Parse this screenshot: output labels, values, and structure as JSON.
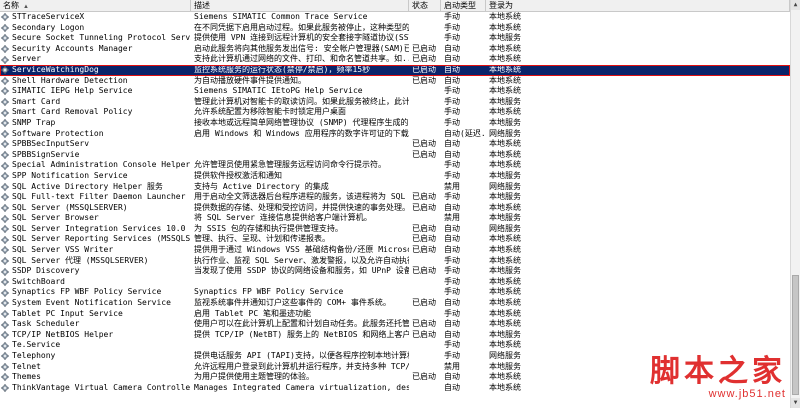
{
  "columns": [
    "名称",
    "描述",
    "状态",
    "启动类型",
    "登录为"
  ],
  "rows": [
    {
      "name": "STTraceServiceX",
      "desc": "Siemens SIMATIC Common Trace Service",
      "status": "",
      "start": "手动",
      "login": "本地系统"
    },
    {
      "name": "Secondary Logon",
      "desc": "在不同凭据下启用启动过程。如果此服务被停止，这种类型的登录...",
      "status": "",
      "start": "手动",
      "login": "本地系统"
    },
    {
      "name": "Secure Socket Tunneling Protocol Service",
      "desc": "提供使用 VPN 连接到远程计算机的安全套接字隧道协议(SSTP)的...",
      "status": "",
      "start": "手动",
      "login": "本地服务"
    },
    {
      "name": "Security Accounts Manager",
      "desc": "启动此服务将向其他服务发出信号: 安全帐户管理器(SAM)已准备...",
      "status": "已启动",
      "start": "自动",
      "login": "本地系统"
    },
    {
      "name": "Server",
      "desc": "支持此计算机通过网络的文件、打印、和命名管道共享。如...",
      "status": "已启动",
      "start": "自动",
      "login": "本地系统"
    },
    {
      "name": "ServiceWatchingDog",
      "desc": "监控系统服务的运行状态(禁停/禁启)，频率15秒",
      "status": "已启动",
      "start": "自动",
      "login": "本地系统",
      "selected": true
    },
    {
      "name": "Shell Hardware Detection",
      "desc": "为自动播放硬件事件提供通知。",
      "status": "已启动",
      "start": "自动",
      "login": "本地系统"
    },
    {
      "name": "SIMATIC IEPG Help Service",
      "desc": "Siemens SIMATIC IEtoPG Help Service",
      "status": "",
      "start": "手动",
      "login": "本地系统"
    },
    {
      "name": "Smart Card",
      "desc": "管理此计算机对智能卡的取读访问。如果此服务被终止，此计算机...",
      "status": "",
      "start": "手动",
      "login": "本地服务"
    },
    {
      "name": "Smart Card Removal Policy",
      "desc": "允许系统配置为移除智能卡时锁定用户桌面",
      "status": "",
      "start": "手动",
      "login": "本地系统"
    },
    {
      "name": "SNMP Trap",
      "desc": "接收本地或远程简单网络管理协议 (SNMP) 代理程序生成的陷阱消...",
      "status": "",
      "start": "手动",
      "login": "本地服务"
    },
    {
      "name": "Software Protection",
      "desc": "启用 Windows 和 Windows 应用程序的数字许可证的下载、安装和...",
      "status": "",
      "start": "自动(延迟...",
      "login": "网络服务"
    },
    {
      "name": "SPBBSecInputServ",
      "desc": "",
      "status": "已启动",
      "start": "自动",
      "login": "本地系统"
    },
    {
      "name": "SPBBSignServie",
      "desc": "",
      "status": "已启动",
      "start": "自动",
      "login": "本地系统"
    },
    {
      "name": "Special Administration Console Helper",
      "desc": "允许管理员使用紧急管理服务远程访问命令行提示符。",
      "status": "",
      "start": "手动",
      "login": "本地系统"
    },
    {
      "name": "SPP Notification Service",
      "desc": "提供软件授权激活和通知",
      "status": "",
      "start": "手动",
      "login": "本地服务"
    },
    {
      "name": "SQL Active Directory Helper 服务",
      "desc": "支持与 Active Directory 的集成",
      "status": "",
      "start": "禁用",
      "login": "网络服务"
    },
    {
      "name": "SQL Full-text Filter Daemon Launcher (MSSQ...",
      "desc": "用于启动全文筛选器后台程序进程的服务，该进程将为 SQL Serve...",
      "status": "已启动",
      "start": "手动",
      "login": "本地服务"
    },
    {
      "name": "SQL Server (MSSQLSERVER)",
      "desc": "提供数据的存储、处理和受控访问，并提供快速的事务处理。",
      "status": "已启动",
      "start": "自动",
      "login": "本地系统"
    },
    {
      "name": "SQL Server Browser",
      "desc": "将 SQL Server 连接信息提供给客户端计算机。",
      "status": "",
      "start": "禁用",
      "login": "本地服务"
    },
    {
      "name": "SQL Server Integration Services 10.0",
      "desc": "为 SSIS 包的存储和执行提供管理支持。",
      "status": "已启动",
      "start": "自动",
      "login": "网络服务"
    },
    {
      "name": "SQL Server Reporting Services (MSSQLSERVER)",
      "desc": "管理、执行、呈现、计划和传递报表。",
      "status": "已启动",
      "start": "自动",
      "login": "本地系统"
    },
    {
      "name": "SQL Server VSS Writer",
      "desc": "提供用于通过 Windows VSS 基础结构备份/还原 Microsoft SQL S...",
      "status": "已启动",
      "start": "自动",
      "login": "本地系统"
    },
    {
      "name": "SQL Server 代理 (MSSQLSERVER)",
      "desc": "执行作业、监视 SQL Server、激发警报，以及允许自动执行某些...",
      "status": "",
      "start": "手动",
      "login": "本地系统"
    },
    {
      "name": "SSDP Discovery",
      "desc": "当发现了使用 SSDP 协议的网络设备和服务，如 UPnP 设备，同时...",
      "status": "已启动",
      "start": "手动",
      "login": "本地服务"
    },
    {
      "name": "SwitchBoard",
      "desc": "",
      "status": "",
      "start": "手动",
      "login": "本地系统"
    },
    {
      "name": "Synaptics FP WBF Policy Service",
      "desc": "Synaptics FP WBF Policy Service",
      "status": "",
      "start": "手动",
      "login": "本地系统"
    },
    {
      "name": "System Event Notification Service",
      "desc": "监视系统事件并通知订户这些事件的 COM+ 事件系统。",
      "status": "已启动",
      "start": "自动",
      "login": "本地系统"
    },
    {
      "name": "Tablet PC Input Service",
      "desc": "启用 Tablet PC 笔和墨迹功能",
      "status": "",
      "start": "手动",
      "login": "本地系统"
    },
    {
      "name": "Task Scheduler",
      "desc": "使用户可以在此计算机上配置和计划自动任务。此服务还托管多个...",
      "status": "已启动",
      "start": "自动",
      "login": "本地系统"
    },
    {
      "name": "TCP/IP NetBIOS Helper",
      "desc": "提供 TCP/IP (NetBT) 服务上的 NetBIOS 和网络上客户端的 NetB...",
      "status": "已启动",
      "start": "自动",
      "login": "本地服务"
    },
    {
      "name": "Te.Service",
      "desc": "",
      "status": "",
      "start": "手动",
      "login": "本地系统"
    },
    {
      "name": "Telephony",
      "desc": "提供电话服务 API (TAPI)支持，以便各程序控制本地计算机上的...",
      "status": "",
      "start": "手动",
      "login": "网络服务"
    },
    {
      "name": "Telnet",
      "desc": "允许远程用户登录到此计算机并运行程序，并支持多种 TCP/IP Te...",
      "status": "",
      "start": "禁用",
      "login": "本地服务"
    },
    {
      "name": "Themes",
      "desc": "为用户提供使用主题管理的体验。",
      "status": "已启动",
      "start": "自动",
      "login": "本地系统"
    },
    {
      "name": "ThinkVantage Virtual Camera Controller",
      "desc": "Manages Integrated Camera virtualization, desktop sharing,...",
      "status": "",
      "start": "自动",
      "login": "本地系统"
    }
  ],
  "watermark": {
    "brand_cn": "脚本之家",
    "url": "www.jb51.net"
  },
  "colors": {
    "selection_bg": "#0a246a",
    "selection_outline": "#e01010",
    "watermark": "#e03030"
  }
}
